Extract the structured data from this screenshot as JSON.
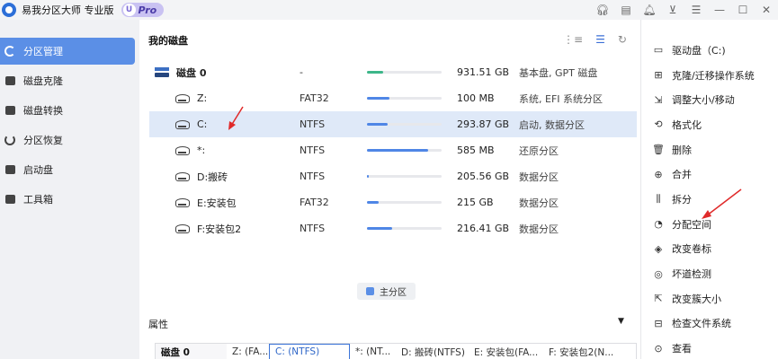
{
  "app": {
    "title": "易我分区大师 专业版",
    "badge_letter": "U",
    "badge_text": "Pro"
  },
  "sidebar": {
    "items": [
      {
        "label": "分区管理",
        "icon": "pie-chart-icon",
        "active": true
      },
      {
        "label": "磁盘克隆",
        "icon": "disk-clone-icon",
        "active": false
      },
      {
        "label": "磁盘转换",
        "icon": "disk-convert-icon",
        "active": false
      },
      {
        "label": "分区恢复",
        "icon": "partition-recovery-icon",
        "active": false
      },
      {
        "label": "启动盘",
        "icon": "boot-disk-icon",
        "active": false
      },
      {
        "label": "工具箱",
        "icon": "toolbox-icon",
        "active": false
      }
    ]
  },
  "main": {
    "title": "我的磁盘",
    "rows": [
      {
        "name": "磁盘 0",
        "fs": "-",
        "usage": 0.22,
        "size": "931.51 GB",
        "type": "基本盘, GPT 磁盘",
        "kind": "disk"
      },
      {
        "name": "Z:",
        "fs": "FAT32",
        "usage": 0.3,
        "size": "100 MB",
        "type": "系统, EFI 系统分区",
        "kind": "part"
      },
      {
        "name": "C:",
        "fs": "NTFS",
        "usage": 0.28,
        "size": "293.87 GB",
        "type": "启动, 数据分区",
        "kind": "part",
        "selected": true
      },
      {
        "name": "*:",
        "fs": "NTFS",
        "usage": 0.82,
        "size": "585 MB",
        "type": "还原分区",
        "kind": "part"
      },
      {
        "name": "D:搬砖",
        "fs": "NTFS",
        "usage": 0.02,
        "size": "205.56 GB",
        "type": "数据分区",
        "kind": "part"
      },
      {
        "name": "E:安装包",
        "fs": "FAT32",
        "usage": 0.16,
        "size": "215 GB",
        "type": "数据分区",
        "kind": "part"
      },
      {
        "name": "F:安装包2",
        "fs": "NTFS",
        "usage": 0.34,
        "size": "216.41 GB",
        "type": "数据分区",
        "kind": "part"
      }
    ],
    "legend": "主分区",
    "properties_label": "属性",
    "strip": [
      "磁盘 0",
      "Z: (FA...",
      "C: (NTFS)",
      "*: (NT...",
      "D: 搬砖(NTFS)",
      "E: 安装包(FA...",
      "F: 安装包2(N..."
    ]
  },
  "actions": {
    "items": [
      {
        "label": "驱动盘（C:)",
        "icon": "drive-icon"
      },
      {
        "label": "克隆/迁移操作系统",
        "icon": "windows-icon"
      },
      {
        "label": "调整大小/移动",
        "icon": "resize-icon"
      },
      {
        "label": "格式化",
        "icon": "format-icon"
      },
      {
        "label": "删除",
        "icon": "trash-icon"
      },
      {
        "label": "合并",
        "icon": "merge-icon"
      },
      {
        "label": "拆分",
        "icon": "split-icon"
      },
      {
        "label": "分配空间",
        "icon": "allocate-icon"
      },
      {
        "label": "改变卷标",
        "icon": "label-icon"
      },
      {
        "label": "坏道检测",
        "icon": "bad-sector-icon"
      },
      {
        "label": "改变簇大小",
        "icon": "cluster-icon"
      },
      {
        "label": "检查文件系统",
        "icon": "check-fs-icon"
      },
      {
        "label": "查看",
        "icon": "view-icon"
      }
    ]
  },
  "colors": {
    "accent": "#5b8fe6",
    "selected_row": "#dfe9f8",
    "annotation_arrow": "#e02a2a"
  }
}
